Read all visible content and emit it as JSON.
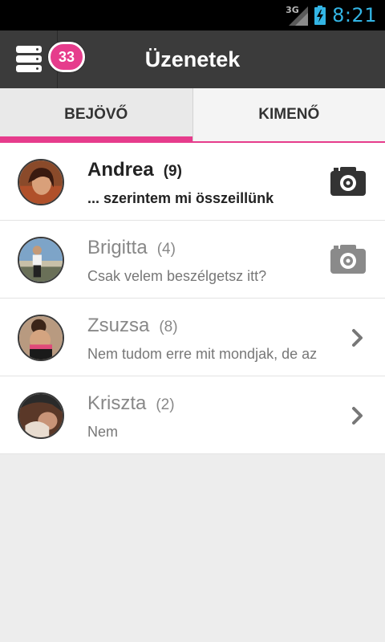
{
  "status_bar": {
    "network": "3G",
    "time": "8:21",
    "icons": [
      "signal-icon",
      "battery-charging-icon"
    ]
  },
  "action_bar": {
    "title": "Üzenetek",
    "badge_count": "33",
    "menu_icon": "server-stack-icon"
  },
  "tabs": [
    {
      "label": "BEJÖVŐ",
      "active": true
    },
    {
      "label": "KIMENŐ",
      "active": false
    }
  ],
  "conversations": [
    {
      "name": "Andrea",
      "count": "(9)",
      "message": "... szerintem mi összeillünk",
      "unread": true,
      "icon": "camera-icon"
    },
    {
      "name": "Brigitta",
      "count": "(4)",
      "message": "Csak velem beszélgetsz itt?",
      "unread": false,
      "icon": "camera-icon"
    },
    {
      "name": "Zsuzsa",
      "count": "(8)",
      "message": "Nem tudom erre mit mondjak, de az",
      "unread": false,
      "icon": "chevron-right-icon"
    },
    {
      "name": "Kriszta",
      "count": "(2)",
      "message": "Nem",
      "unread": false,
      "icon": "chevron-right-icon"
    }
  ],
  "colors": {
    "accent": "#e63c8c",
    "action_bar": "#3b3b3b",
    "clock": "#33b5e5"
  }
}
